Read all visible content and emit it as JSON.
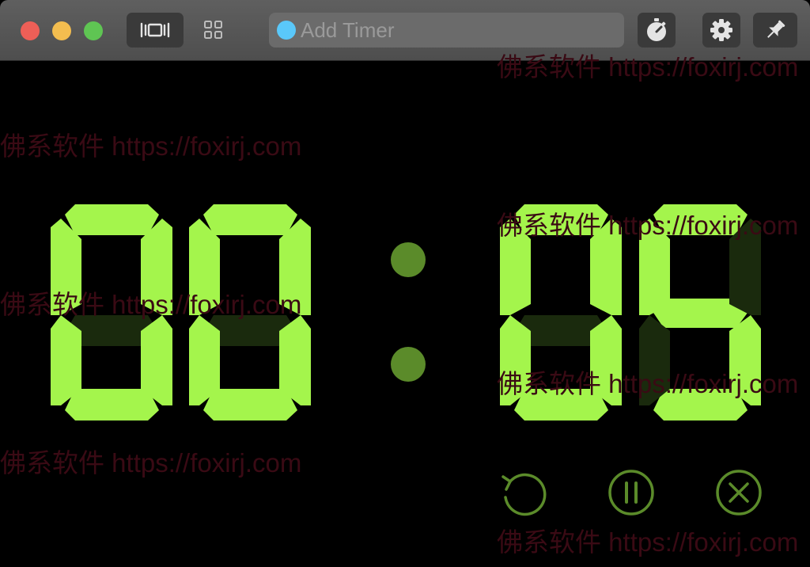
{
  "window": {
    "traffic_lights": [
      "close",
      "minimize",
      "zoom"
    ],
    "toolbar": {
      "view_full_icon": "fullscreen-view-icon",
      "view_grid_icon": "grid-view-icon",
      "add_timer_placeholder": "Add Timer",
      "add_timer_dot_color": "#5ac8fa",
      "stopwatch_icon": "stopwatch-icon",
      "settings_icon": "gear-icon",
      "pin_icon": "pin-icon"
    }
  },
  "display": {
    "time": "00:05",
    "digit_color": "#a4f54c",
    "colon_color": "#5b8b2a",
    "ghost_color": "#1a2a0d"
  },
  "controls": {
    "restart_icon": "restart-icon",
    "pause_icon": "pause-icon",
    "cancel_icon": "cancel-icon",
    "color": "#5b8b2a"
  },
  "watermark": {
    "text": "佛系软件 https://foxirj.com"
  }
}
